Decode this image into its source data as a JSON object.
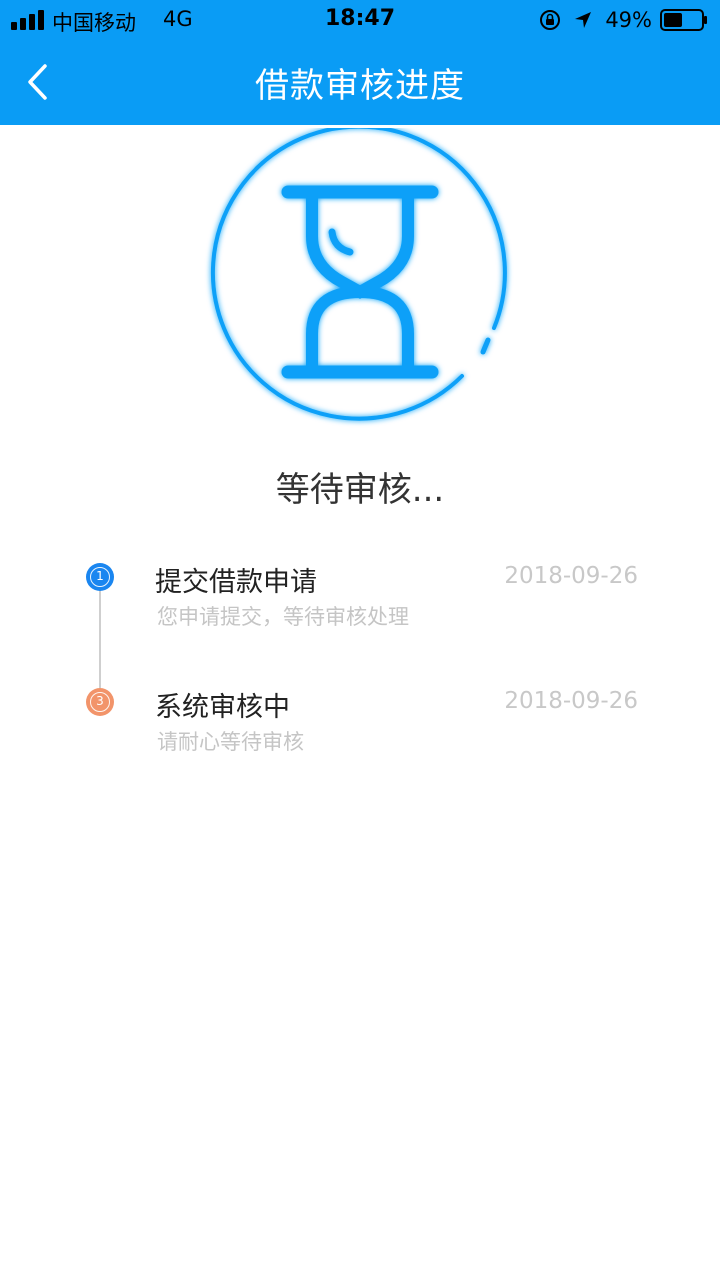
{
  "status_bar": {
    "carrier": "中国移动",
    "network": "4G",
    "time": "18:47",
    "battery_percent": "49%"
  },
  "nav": {
    "title": "借款审核进度"
  },
  "status_label": "等待审核...",
  "steps": [
    {
      "number": "1",
      "title": "提交借款申请",
      "description": "您申请提交，等待审核处理",
      "date": "2018-09-26",
      "color": "#1a86f0"
    },
    {
      "number": "3",
      "title": "系统审核中",
      "description": "请耐心等待审核",
      "date": "2018-09-26",
      "color": "#f2946a"
    }
  ],
  "colors": {
    "brand": "#0a9cf5",
    "illustration": "#0aa0f8"
  },
  "icons": {
    "back": "chevron-left-icon",
    "illustration": "hourglass-icon"
  }
}
